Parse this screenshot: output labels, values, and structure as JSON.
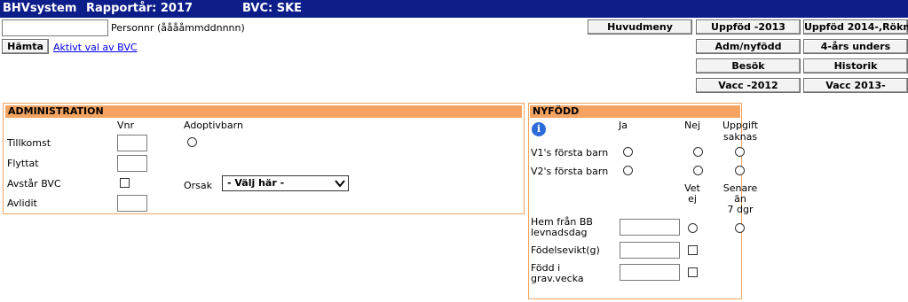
{
  "header": {
    "app": "BHVsystem",
    "year": "Rapportår: 2017",
    "bvc": "BVC: SKE"
  },
  "personnr": {
    "value": "",
    "label": "Personnr (ååååmmddnnnn)"
  },
  "actions": {
    "hamta": "Hämta",
    "aktivt_val": "Aktivt val av BVC"
  },
  "nav": {
    "huvudmeny": "Huvudmeny",
    "uppfod_2013": "Uppföd -2013",
    "uppfod_2014": "Uppföd 2014-,Rökn",
    "adm_nyfodd": "Adm/nyfödd",
    "fyra_ars": "4-års unders",
    "besok": "Besök",
    "historik": "Historik",
    "vacc_2012": "Vacc -2012",
    "vacc_2013": "Vacc 2013-"
  },
  "administration": {
    "title": "ADMINISTRATION",
    "col_vnr": "Vnr",
    "col_adoptiv": "Adoptivbarn",
    "tillkomst": "Tillkomst",
    "flyttat": "Flyttat",
    "avstar": "Avstår BVC",
    "avlidit": "Avlidit",
    "orsak_label": "Orsak",
    "orsak_value": "- Välj här -"
  },
  "nyfodd": {
    "title": "NYFÖDD",
    "col_ja": "Ja",
    "col_nej": "Nej",
    "col_uppgift_1": "Uppgift",
    "col_uppgift_2": "saknas",
    "v1": "V1's första barn",
    "v2": "V2's första barn",
    "col_vet_1": "Vet",
    "col_vet_2": "ej",
    "col_senare_1": "Senare",
    "col_senare_2": "än",
    "col_senare_3": "7 dgr",
    "hem_1": "Hem från BB",
    "hem_2": "levnadsdag",
    "fodelsevikt": "Födelsevikt(g)",
    "fodd_1": "Född i",
    "fodd_2": "grav.vecka"
  },
  "icons": {
    "info": "info-icon",
    "dropdown": "chevron-down-icon"
  },
  "colors": {
    "header_bg": "#0d1e8a",
    "panel_accent": "#f4a460"
  }
}
